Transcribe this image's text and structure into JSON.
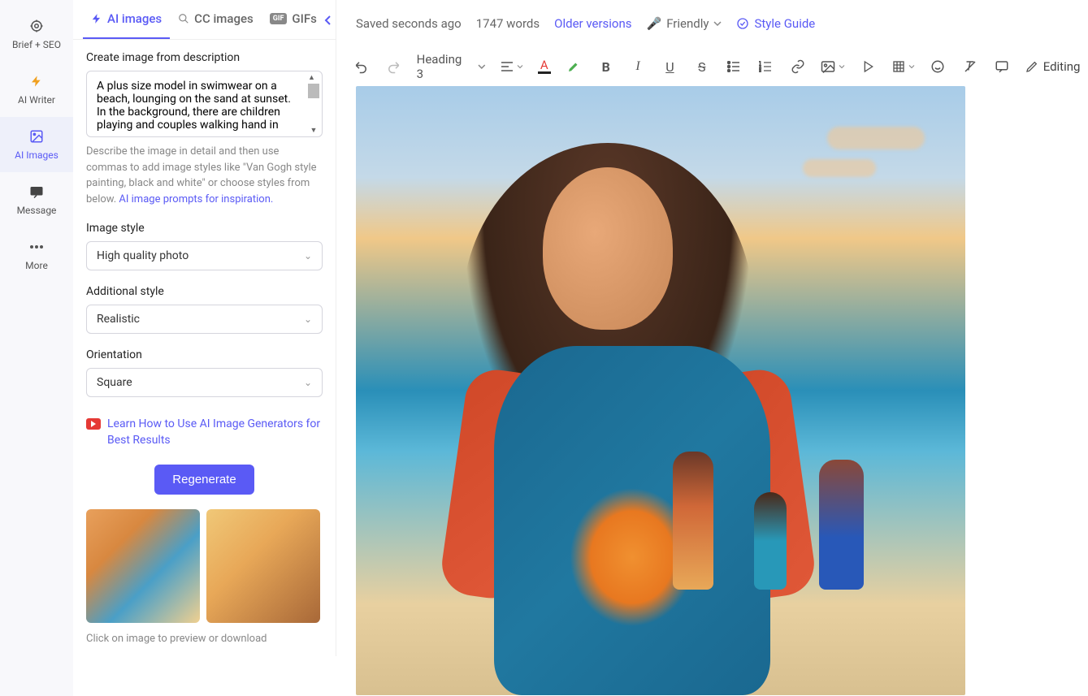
{
  "leftbar": {
    "items": [
      {
        "label": "Brief + SEO"
      },
      {
        "label": "AI Writer"
      },
      {
        "label": "AI Images"
      },
      {
        "label": "Message"
      },
      {
        "label": "More"
      }
    ]
  },
  "tabs": {
    "ai_images": "AI images",
    "cc_images": "CC images",
    "gifs": "GIFs",
    "gif_badge": "GIF"
  },
  "panel": {
    "create_label": "Create image from description",
    "description_value": "A plus size model in swimwear on a beach, lounging on the sand at sunset. In the background, there are children playing and couples walking hand in",
    "hint_prefix": "Describe the image in detail and then use commas to add image styles like \"Van Gogh style painting, black and white\" or choose styles from below. ",
    "hint_link": "AI image prompts for inspiration.",
    "style_label": "Image style",
    "style_value": "High quality photo",
    "additional_label": "Additional style",
    "additional_value": "Realistic",
    "orientation_label": "Orientation",
    "orientation_value": "Square",
    "learn_link": "Learn How to Use AI Image Generators for Best Results",
    "regenerate": "Regenerate",
    "thumb_hint": "Click on image to preview or download"
  },
  "topbar": {
    "saved": "Saved seconds ago",
    "words": "1747 words",
    "older": "Older versions",
    "tone": "Friendly",
    "style_guide": "Style Guide"
  },
  "toolbar": {
    "heading": "Heading 3",
    "editing": "Editing"
  }
}
